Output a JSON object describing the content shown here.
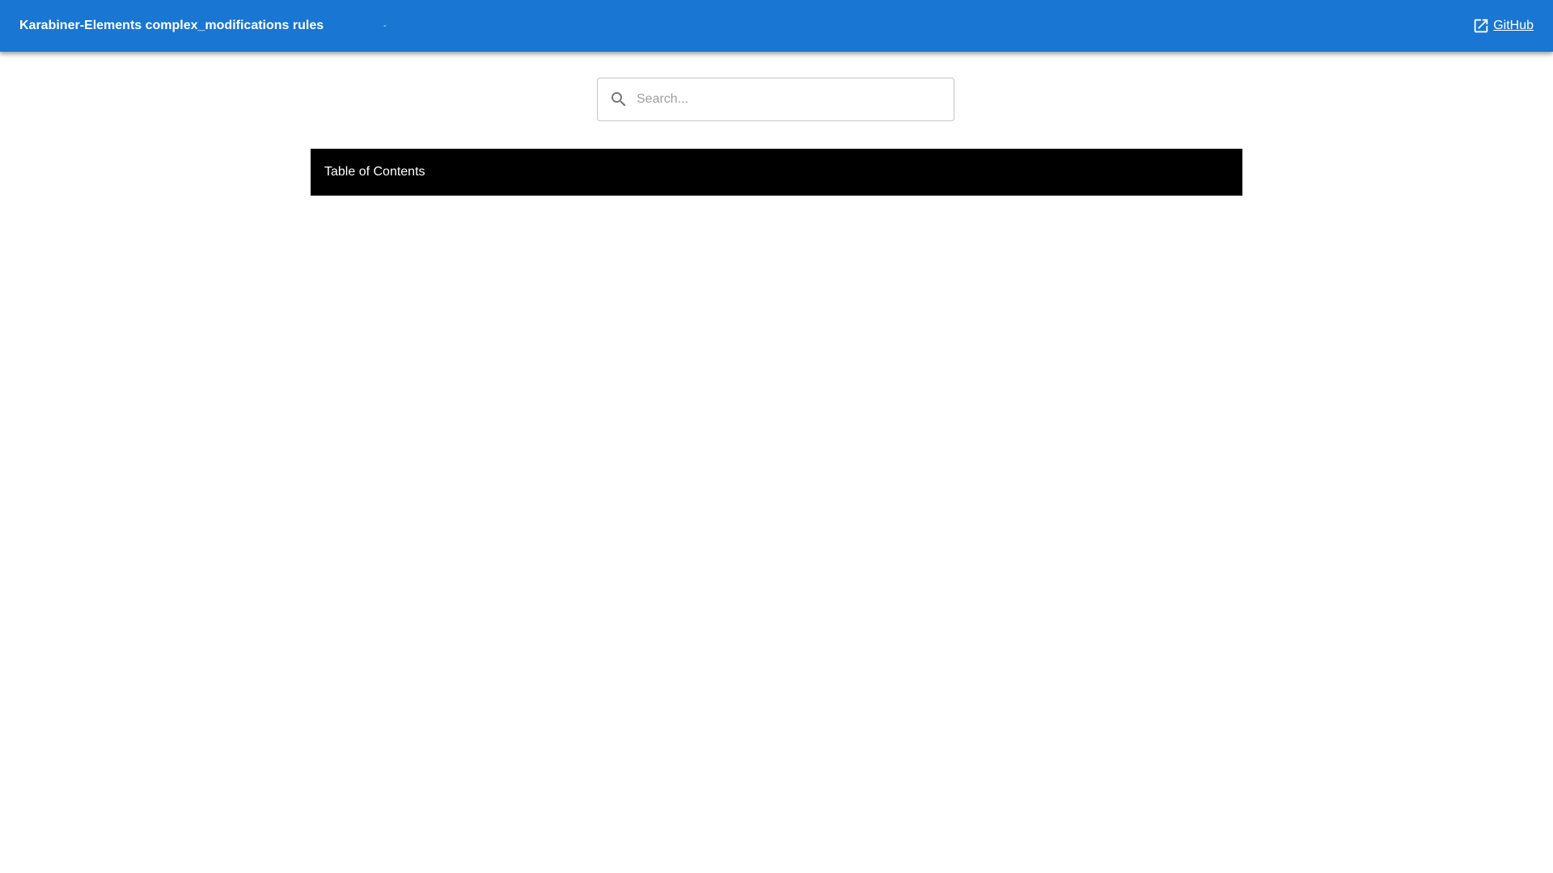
{
  "header": {
    "title": "Karabiner-Elements complex_modifications rules",
    "separator": "-",
    "github_link_label": "GitHub",
    "github_icon": "open-in-new-icon",
    "background_color": "#1976d2"
  },
  "search": {
    "placeholder": "Search...",
    "value": "",
    "icon": "search-icon"
  },
  "toc": {
    "label": "Table of Contents",
    "background_color": "#000000"
  }
}
